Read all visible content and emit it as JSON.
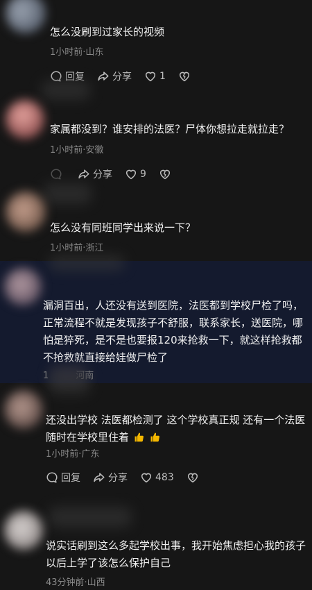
{
  "comments": [
    {
      "text": "怎么没刷到过家长的视频",
      "meta": "1小时前·山东",
      "reply_label": "回复",
      "share_label": "分享",
      "likes": "1"
    },
    {
      "text": "家属都没到？谁安排的法医？尸体你想拉走就拉走？",
      "meta": "1小时前·安徽",
      "reply_label": "",
      "share_label": "分享",
      "likes": "9"
    },
    {
      "text": "怎么没有同班同学出来说一下？",
      "meta": "1小时前·浙江"
    },
    {
      "text": "漏洞百出，人还没有送到医院，法医都到学校尸检了吗，正常流程不就是发现孩子不舒服，联系家长，送医院，哪怕是猝死，是不是也要报120来抢救一下，就这样抢救都不抢救就直接给娃做尸检了",
      "meta": "1　　　河南"
    },
    {
      "text": "还没出学校 法医都检测了 这个学校真正规 还有一个法医随时在学校里住着",
      "meta": "1小时前·广东",
      "reply_label": "回复",
      "share_label": "分享",
      "likes": "483",
      "emoji": [
        "thumbs-up",
        "thumbs-up"
      ]
    },
    {
      "text": "说实话刷到这么多起学校出事，我开始焦虑担心我的孩子以后上学了该怎么保护自己",
      "meta": "43分钟前·山西"
    }
  ],
  "icons": {
    "reply": "reply-icon",
    "share": "share-icon",
    "like": "heart-icon",
    "dislike": "broken-heart-icon"
  },
  "colors": {
    "background": "#161616",
    "highlight_background": "#141a2e",
    "text": "#f1f1f1",
    "meta": "#8a8a8a",
    "emoji": "#f5b800"
  }
}
